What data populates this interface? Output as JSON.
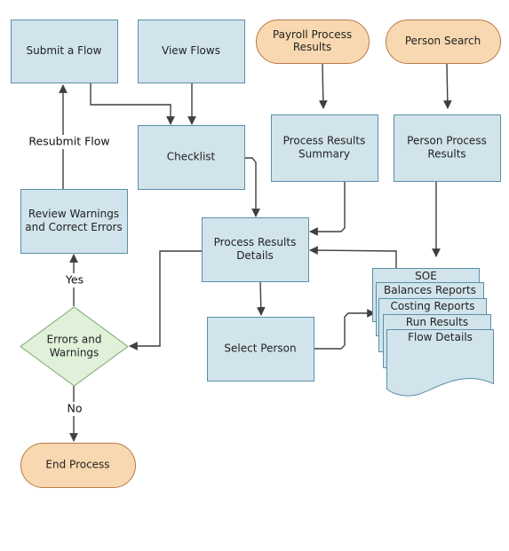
{
  "diagram": {
    "type": "flowchart",
    "colors": {
      "process_fill": "#d1e4ec",
      "process_stroke": "#5b8fa8",
      "terminator_fill": "#f8d8b0",
      "terminator_stroke": "#b87a45",
      "decision_fill": "#dff1d9",
      "decision_stroke": "#7ba86d",
      "connector": "#3f3f3f"
    },
    "nodes": [
      {
        "id": "submit-flow",
        "shape": "process",
        "label": [
          "Submit a Flow"
        ]
      },
      {
        "id": "view-flows",
        "shape": "process",
        "label": [
          "View Flows"
        ]
      },
      {
        "id": "payroll-process-results",
        "shape": "terminator",
        "label": [
          "Payroll Process",
          "Results"
        ]
      },
      {
        "id": "person-search",
        "shape": "terminator",
        "label": [
          "Person Search"
        ]
      },
      {
        "id": "checklist",
        "shape": "process",
        "label": [
          "Checklist"
        ]
      },
      {
        "id": "process-results-summary",
        "shape": "process",
        "label": [
          "Process Results",
          "Summary"
        ]
      },
      {
        "id": "person-process-results",
        "shape": "process",
        "label": [
          "Person Process",
          "Results"
        ]
      },
      {
        "id": "review-warnings",
        "shape": "process",
        "label": [
          "Review Warnings",
          "and Correct Errors"
        ]
      },
      {
        "id": "process-results-details",
        "shape": "process",
        "label": [
          "Process Results",
          "Details"
        ]
      },
      {
        "id": "errors-and-warnings",
        "shape": "decision",
        "label": [
          "Errors and",
          "Warnings"
        ]
      },
      {
        "id": "select-person",
        "shape": "process",
        "label": [
          "Select Person"
        ]
      },
      {
        "id": "end-process",
        "shape": "terminator",
        "label": [
          "End Process"
        ]
      },
      {
        "id": "reports-stack",
        "shape": "multi-document",
        "pages": [
          "SOE",
          "Balances Reports",
          "Costing Reports",
          "Run Results",
          "Flow Details"
        ]
      }
    ],
    "edges": [
      {
        "from": "submit-flow",
        "to": "checklist",
        "label": ""
      },
      {
        "from": "view-flows",
        "to": "checklist",
        "label": ""
      },
      {
        "from": "payroll-process-results",
        "to": "process-results-summary",
        "label": ""
      },
      {
        "from": "person-search",
        "to": "person-process-results",
        "label": ""
      },
      {
        "from": "checklist",
        "to": "process-results-details",
        "label": ""
      },
      {
        "from": "process-results-summary",
        "to": "process-results-details",
        "label": ""
      },
      {
        "from": "reports-stack",
        "to": "process-results-details",
        "label": ""
      },
      {
        "from": "person-process-results",
        "to": "reports-stack",
        "label": ""
      },
      {
        "from": "process-results-details",
        "to": "select-person",
        "label": ""
      },
      {
        "from": "process-results-details",
        "to": "errors-and-warnings",
        "label": ""
      },
      {
        "from": "select-person",
        "to": "reports-stack",
        "label": ""
      },
      {
        "from": "review-warnings",
        "to": "submit-flow",
        "label": "Resubmit Flow"
      },
      {
        "from": "errors-and-warnings",
        "to": "review-warnings",
        "label": "Yes"
      },
      {
        "from": "errors-and-warnings",
        "to": "end-process",
        "label": "No"
      }
    ]
  }
}
